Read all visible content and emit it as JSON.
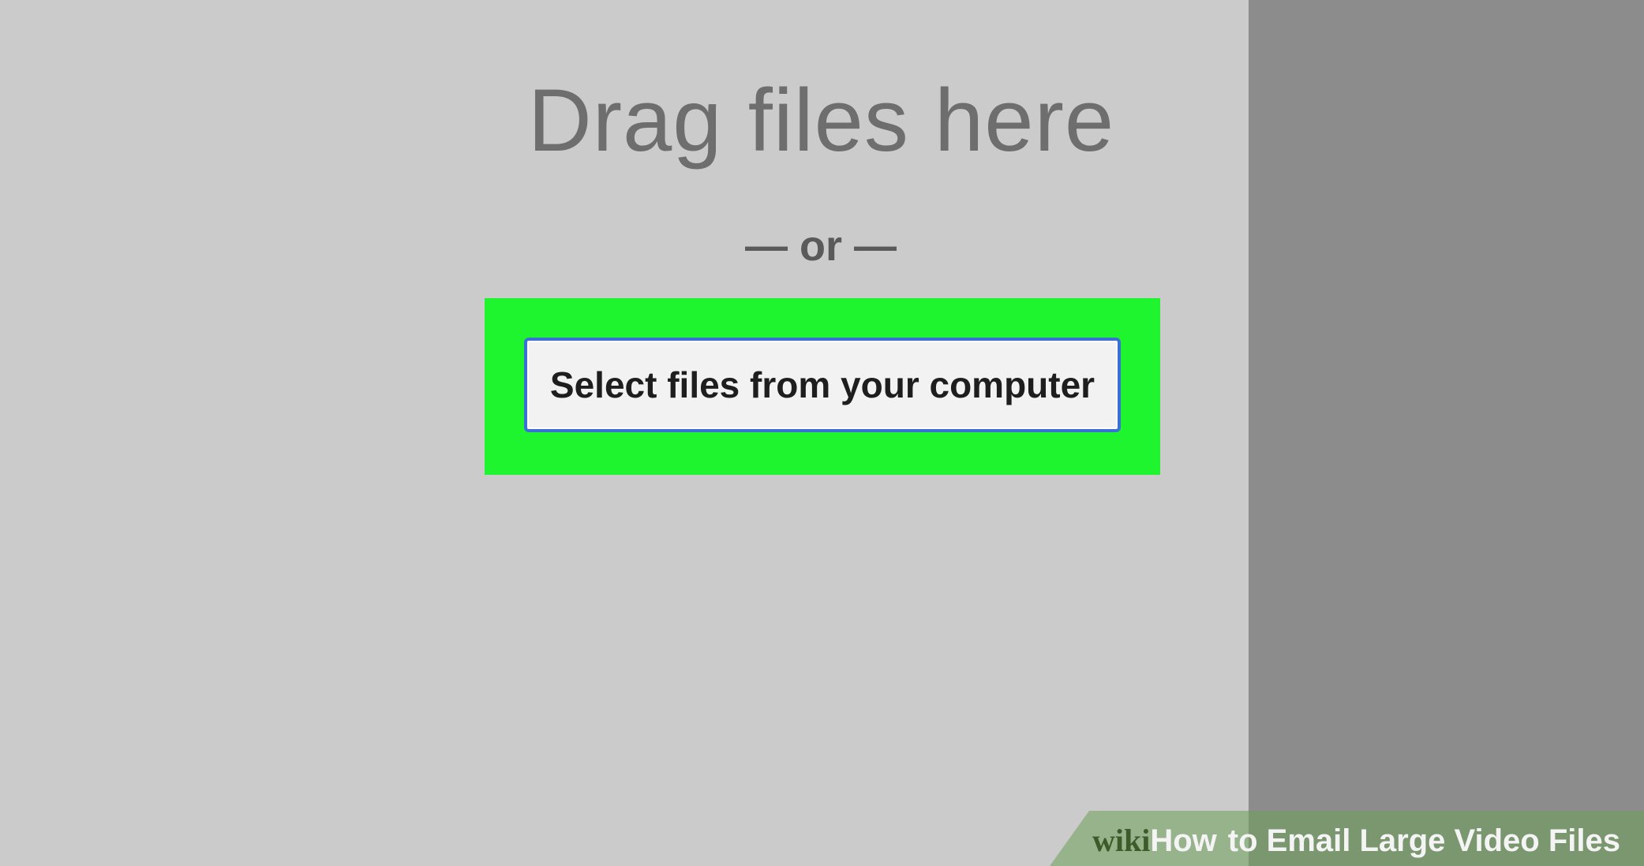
{
  "upload": {
    "drag_text": "Drag files here",
    "divider_text": "— or —",
    "select_button_label": "Select files from your computer"
  },
  "watermark": {
    "wiki": "wiki",
    "how": "How",
    "title": "to Email Large Video Files"
  },
  "colors": {
    "highlight": "#1ff52e",
    "pane_background": "#cbcbcb",
    "overlay": "#8c8c8c",
    "button_border": "#3a6fd8"
  }
}
